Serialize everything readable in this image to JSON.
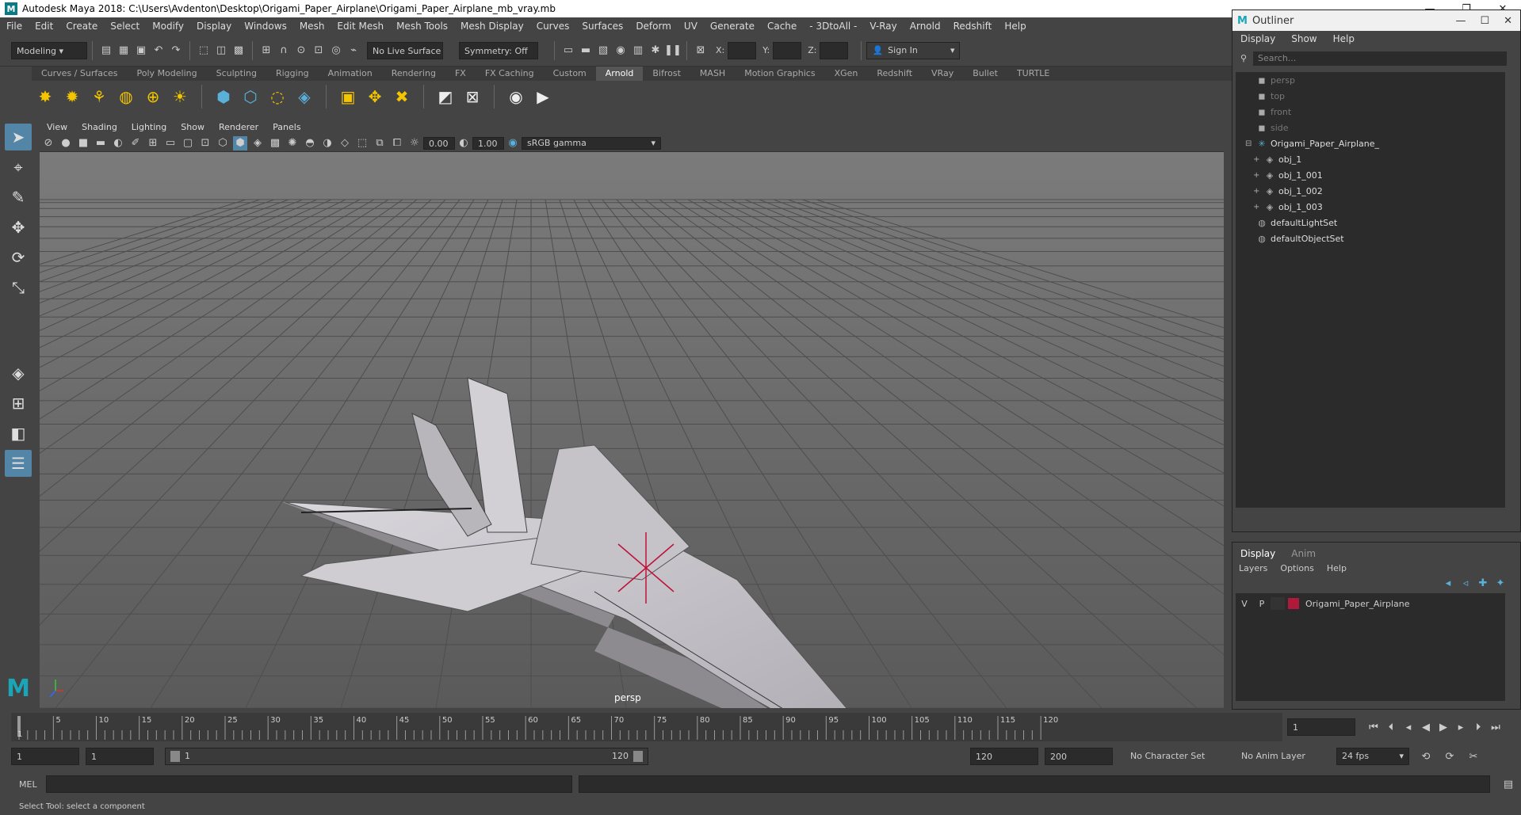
{
  "window": {
    "title": "Autodesk Maya 2018: C:\\Users\\Avdenton\\Desktop\\Origami_Paper_Airplane\\Origami_Paper_Airplane_mb_vray.mb",
    "logo_letter": "M"
  },
  "menubar": [
    "File",
    "Edit",
    "Create",
    "Select",
    "Modify",
    "Display",
    "Windows",
    "Mesh",
    "Edit Mesh",
    "Mesh Tools",
    "Mesh Display",
    "Curves",
    "Surfaces",
    "Deform",
    "UV",
    "Generate",
    "Cache",
    "- 3DtoAll -",
    "V-Ray",
    "Arnold",
    "Redshift",
    "Help"
  ],
  "statusline": {
    "mode": "Modeling",
    "live_surface": "No Live Surface",
    "symmetry": "Symmetry: Off",
    "x_label": "X:",
    "y_label": "Y:",
    "z_label": "Z:",
    "sign_in": "Sign In"
  },
  "shelf": {
    "tabs": [
      "Curves / Surfaces",
      "Poly Modeling",
      "Sculpting",
      "Rigging",
      "Animation",
      "Rendering",
      "FX",
      "FX Caching",
      "Custom",
      "Arnold",
      "Bifrost",
      "MASH",
      "Motion Graphics",
      "XGen",
      "Redshift",
      "VRay",
      "Bullet",
      "TURTLE"
    ],
    "active_tab": "Arnold"
  },
  "viewport": {
    "menu": [
      "View",
      "Shading",
      "Lighting",
      "Show",
      "Renderer",
      "Panels"
    ],
    "exposure": "0.00",
    "gamma": "1.00",
    "color_space": "sRGB gamma",
    "camera_label": "persp"
  },
  "outliner": {
    "title": "Outliner",
    "menu": [
      "Display",
      "Show",
      "Help"
    ],
    "search_placeholder": "Search...",
    "items": [
      {
        "label": "persp",
        "icon": "camera-icon",
        "dim": true,
        "indent": 0
      },
      {
        "label": "top",
        "icon": "camera-icon",
        "dim": true,
        "indent": 0
      },
      {
        "label": "front",
        "icon": "camera-icon",
        "dim": true,
        "indent": 0
      },
      {
        "label": "side",
        "icon": "camera-icon",
        "dim": true,
        "indent": 0
      },
      {
        "label": "Origami_Paper_Airplane_",
        "icon": "group-icon",
        "dim": false,
        "indent": 0
      },
      {
        "label": "obj_1",
        "icon": "mesh-icon",
        "dim": false,
        "indent": 1
      },
      {
        "label": "obj_1_001",
        "icon": "mesh-icon",
        "dim": false,
        "indent": 1
      },
      {
        "label": "obj_1_002",
        "icon": "mesh-icon",
        "dim": false,
        "indent": 1
      },
      {
        "label": "obj_1_003",
        "icon": "mesh-icon",
        "dim": false,
        "indent": 1
      },
      {
        "label": "defaultLightSet",
        "icon": "set-icon",
        "dim": false,
        "indent": 0
      },
      {
        "label": "defaultObjectSet",
        "icon": "set-icon",
        "dim": false,
        "indent": 0
      }
    ]
  },
  "layers": {
    "tabs": [
      "Display",
      "Anim"
    ],
    "menu": [
      "Layers",
      "Options",
      "Help"
    ],
    "layer": {
      "v": "V",
      "p": "P",
      "name": "Origami_Paper_Airplane",
      "color": "#b01a3a"
    }
  },
  "timeline": {
    "ticks": [
      "5",
      "10",
      "15",
      "20",
      "25",
      "30",
      "35",
      "40",
      "45",
      "50",
      "55",
      "60",
      "65",
      "70",
      "75",
      "80",
      "85",
      "90",
      "95",
      "100",
      "105",
      "110",
      "115",
      "120"
    ],
    "start_mark": "1",
    "current_frame": "1"
  },
  "range": {
    "start": "1",
    "start2": "1",
    "range_start": "1",
    "range_end": "120",
    "end": "120",
    "anim_end": "200",
    "character_set": "No Character Set",
    "anim_layer": "No Anim Layer",
    "fps": "24 fps"
  },
  "cmd": {
    "lang": "MEL"
  },
  "help": {
    "text": "Select Tool: select a component"
  }
}
